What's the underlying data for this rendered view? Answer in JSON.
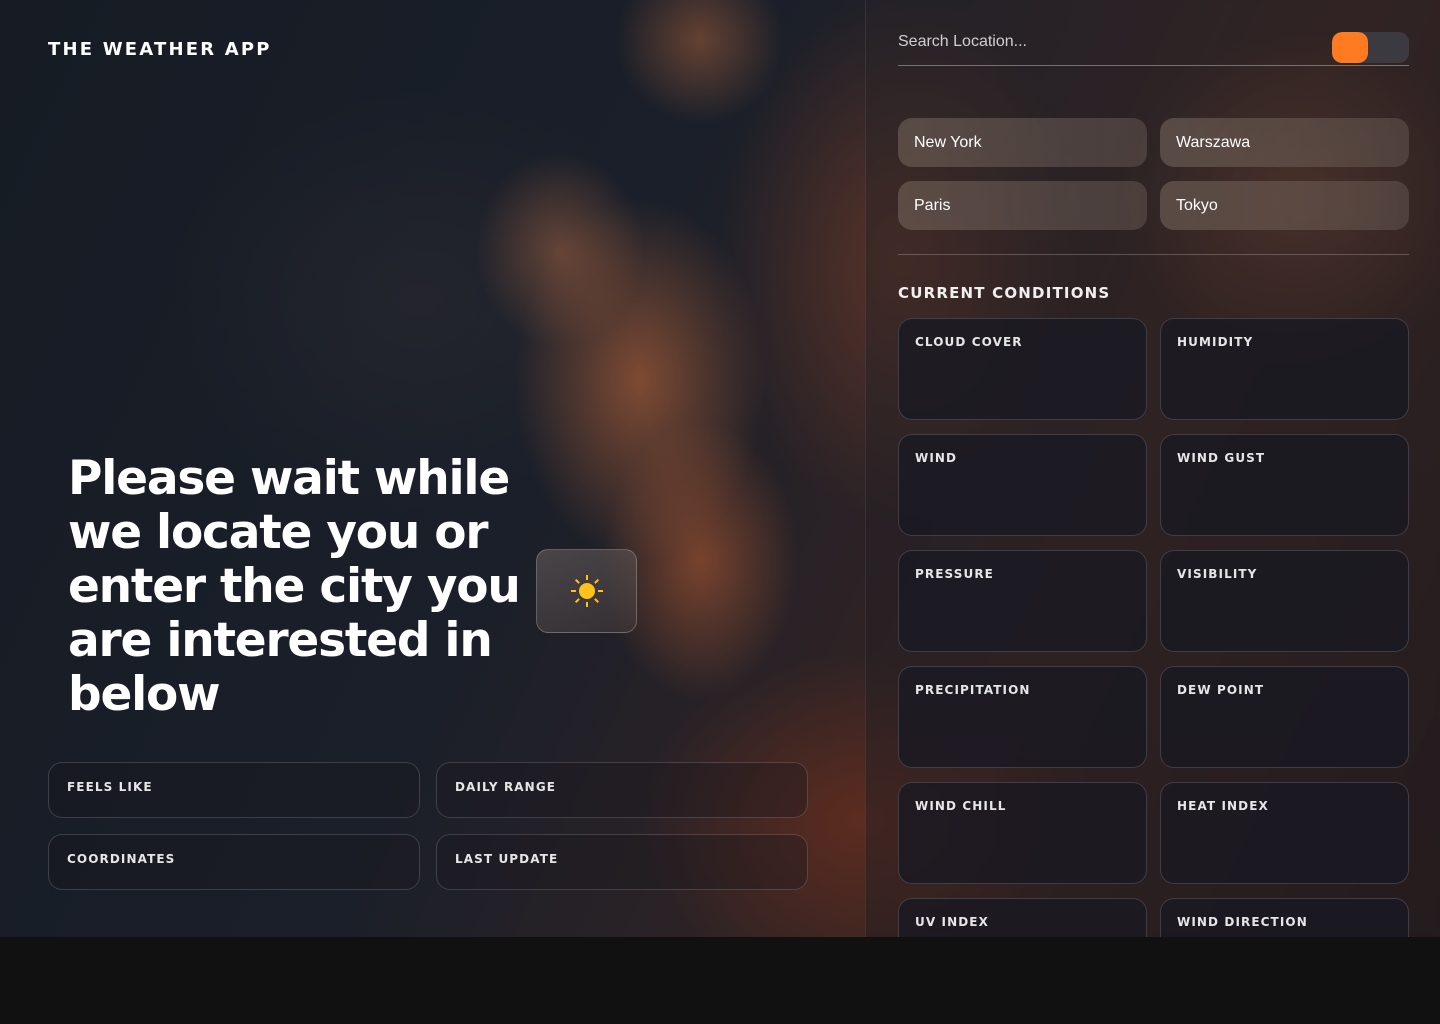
{
  "app": {
    "title": "THE WEATHER APP"
  },
  "main": {
    "headline": "Please wait while we locate you or enter the city you are interested in below",
    "weather_icon": "sun-icon",
    "cards": [
      {
        "label": "FEELS LIKE"
      },
      {
        "label": "DAILY RANGE"
      },
      {
        "label": "COORDINATES"
      },
      {
        "label": "LAST UPDATE"
      }
    ]
  },
  "panel": {
    "search": {
      "placeholder": "Search Location...",
      "value": ""
    },
    "cities": [
      "New York",
      "Warszawa",
      "Paris",
      "Tokyo"
    ],
    "section_title": "CURRENT CONDITIONS",
    "conditions": [
      {
        "label": "CLOUD COVER"
      },
      {
        "label": "HUMIDITY"
      },
      {
        "label": "WIND"
      },
      {
        "label": "WIND GUST"
      },
      {
        "label": "PRESSURE"
      },
      {
        "label": "VISIBILITY"
      },
      {
        "label": "PRECIPITATION"
      },
      {
        "label": "DEW POINT"
      },
      {
        "label": "WIND CHILL"
      },
      {
        "label": "HEAT INDEX"
      },
      {
        "label": "UV INDEX"
      },
      {
        "label": "WIND DIRECTION"
      }
    ]
  },
  "colors": {
    "accent": "#ff7a21",
    "sun": "#ffc21a",
    "toggle_track": "#3a3a40"
  }
}
